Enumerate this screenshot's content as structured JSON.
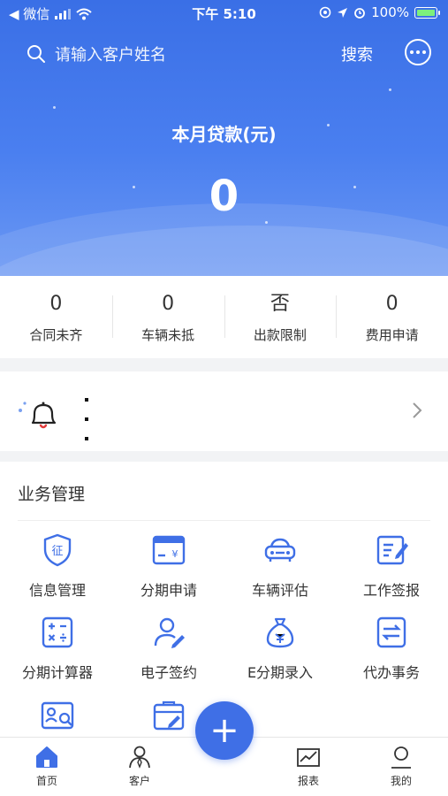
{
  "status_bar": {
    "back_app": "◀ 微信",
    "time": "下午 5:10",
    "battery": "100%"
  },
  "header": {
    "search_placeholder": "请输入客户姓名",
    "search_button": "搜索",
    "loan_title": "本月贷款(元)",
    "loan_value": "0"
  },
  "stats": [
    {
      "value": "0",
      "label": "合同未齐"
    },
    {
      "value": "0",
      "label": "车辆未抵"
    },
    {
      "value": "否",
      "label": "出款限制"
    },
    {
      "value": "0",
      "label": "费用申请"
    }
  ],
  "business": {
    "title": "业务管理",
    "items": [
      {
        "label": "信息管理",
        "icon": "shield-icon"
      },
      {
        "label": "分期申请",
        "icon": "card-icon"
      },
      {
        "label": "车辆评估",
        "icon": "car-icon"
      },
      {
        "label": "工作签报",
        "icon": "edit-doc-icon"
      },
      {
        "label": "分期计算器",
        "icon": "calculator-icon"
      },
      {
        "label": "电子签约",
        "icon": "user-sign-icon"
      },
      {
        "label": "E分期录入",
        "icon": "money-bag-icon"
      },
      {
        "label": "代办事务",
        "icon": "transfer-icon"
      },
      {
        "label": "",
        "icon": "id-card-search-icon"
      },
      {
        "label": "",
        "icon": "briefcase-edit-icon"
      }
    ]
  },
  "tabbar": {
    "home": "首页",
    "customer": "客户",
    "report": "报表",
    "mine": "我的",
    "fab": "+"
  },
  "colors": {
    "primary": "#3f6fe6",
    "header_blue": "#4a7ff0"
  }
}
